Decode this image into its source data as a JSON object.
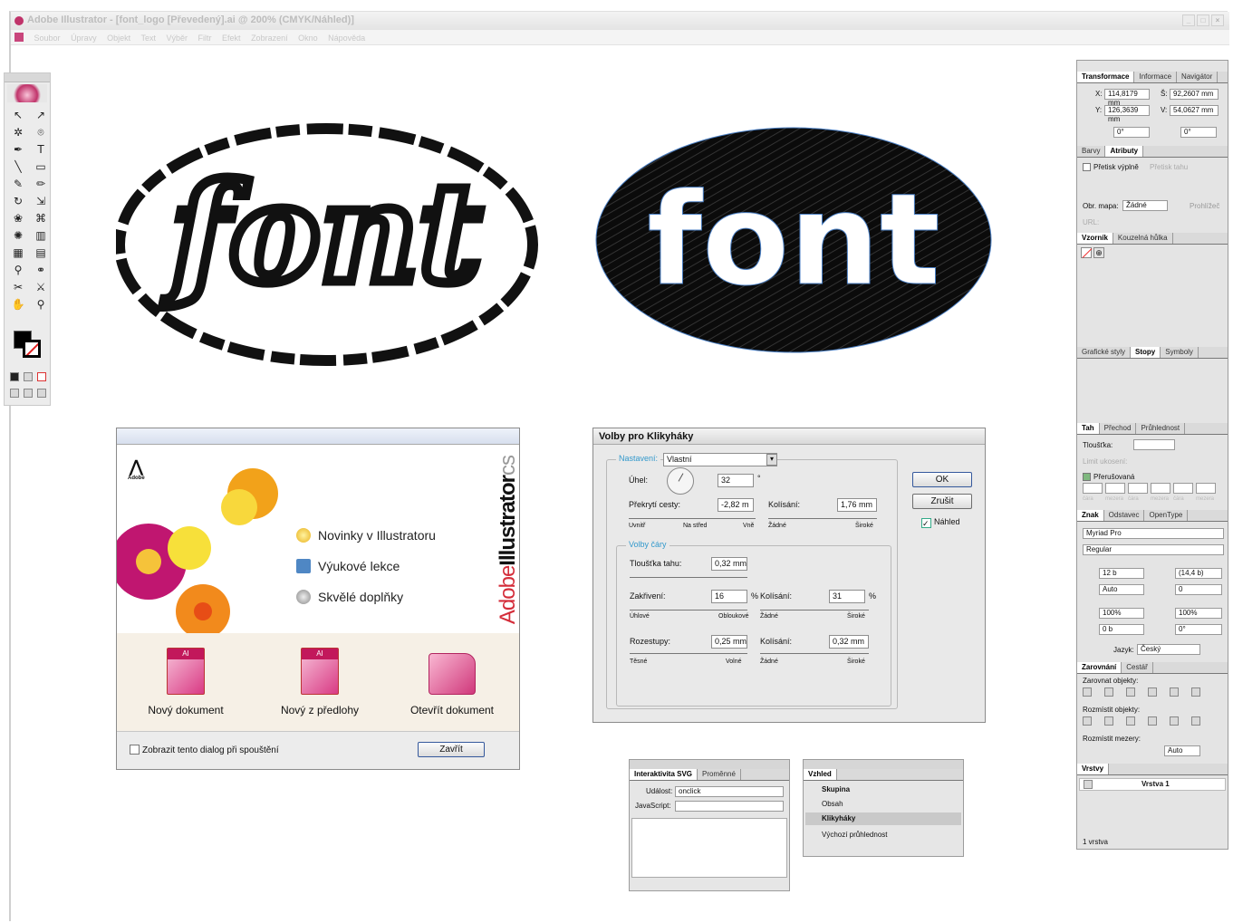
{
  "window": {
    "title": "Adobe Illustrator - [font_logo [Převedený].ai @ 200% (CMYK/Náhled)]",
    "buttons": [
      "_",
      "□",
      "×"
    ]
  },
  "menu": {
    "items": [
      "Soubor",
      "Úpravy",
      "Objekt",
      "Text",
      "Výběr",
      "Filtr",
      "Efekt",
      "Zobrazení",
      "Okno",
      "Nápověda"
    ]
  },
  "artwork": {
    "left_text": "font",
    "right_text": "font"
  },
  "welcome": {
    "brand_adobe": "Adobe",
    "brand_product": "Illustrator",
    "brand_cs": "cs",
    "adobe_logo_text": "Adobe",
    "links": [
      "Novinky v Illustratoru",
      "Výukové lekce",
      "Skvělé doplňky"
    ],
    "docs": [
      "Nový dokument",
      "Nový z předlohy",
      "Otevřít dokument"
    ],
    "doc_badge": "AI",
    "checkbox": "Zobrazit tento dialog při spouštění",
    "close": "Zavřít"
  },
  "scribble": {
    "title": "Volby pro Klikyháky",
    "settings_label": "Nastavení:",
    "settings_value": "Vlastní",
    "angle_label": "Úhel:",
    "angle_value": "32",
    "angle_unit": "°",
    "overlap_label": "Překrytí cesty:",
    "overlap_value": "-2,82 m",
    "variation_label": "Kolísání:",
    "overlap_var_value": "1,76 mm",
    "overlap_ticks": [
      "Uvnitř",
      "Na střed",
      "Vně"
    ],
    "var_ticks": [
      "Žádné",
      "Široké"
    ],
    "line_options": "Volby čáry",
    "stroke_width_label": "Tloušťka tahu:",
    "stroke_width_value": "0,32 mm",
    "curviness_label": "Zakřivení:",
    "curviness_value": "16",
    "curviness_var": "31",
    "percent": "%",
    "curve_ticks": [
      "Úhlové",
      "Obloukové"
    ],
    "spacing_label": "Rozestupy:",
    "spacing_value": "0,25 mm",
    "spacing_var": "0,32 mm",
    "spacing_ticks": [
      "Těsné",
      "Volné"
    ],
    "ok": "OK",
    "cancel": "Zrušit",
    "preview": "Náhled"
  },
  "svg_panel": {
    "tabs": [
      "Interaktivita SVG",
      "Proměnné"
    ],
    "event_label": "Událost:",
    "event_value": "onclick",
    "js_label": "JavaScript:"
  },
  "appearance_panel": {
    "tab": "Vzhled",
    "rows": [
      "Skupina",
      "Obsah",
      "Klikyháky",
      "Výchozí průhlednost"
    ]
  },
  "right": {
    "transform_tabs": [
      "Transformace",
      "Informace",
      "Navigátor"
    ],
    "x_label": "X:",
    "x": "114,8179 mm",
    "w_label": "Š:",
    "w": "92,2607 mm",
    "y_label": "Y:",
    "y": "126,3639 mm",
    "h_label": "V:",
    "h": "54,0627 mm",
    "angle1": "0°",
    "angle2": "0°",
    "attr_tabs": [
      "Barvy",
      "Atributy"
    ],
    "overprint": "Přetisk výplně",
    "overprint2": "Přetisk tahu",
    "imgmap_label": "Obr. mapa:",
    "imgmap_value": "Žádné",
    "browser": "Prohlížeč",
    "url_label": "URL:",
    "swatch_tabs": [
      "Vzorník",
      "Kouzelná hůlka"
    ],
    "style_tabs": [
      "Grafické styly",
      "Stopy",
      "Symboly"
    ],
    "stroke_tabs": [
      "Tah",
      "Přechod",
      "Průhlednost"
    ],
    "weight_label": "Tloušťka:",
    "limit_label": "Limit ukosení:",
    "dashed": "Přerušovaná",
    "dash_labels": [
      "čára",
      "mezera",
      "čára",
      "mezera",
      "čára",
      "mezera"
    ],
    "char_tabs": [
      "Znak",
      "Odstavec",
      "OpenType"
    ],
    "font": "Myriad Pro",
    "style": "Regular",
    "size": "12 b",
    "leading": "(14,4 b)",
    "kern": "Auto",
    "track": "0",
    "hscale": "100%",
    "vscale": "100%",
    "baseline": "0 b",
    "rotate": "0°",
    "lang_label": "Jazyk:",
    "lang": "Český",
    "align_tabs": [
      "Zarovnání",
      "Cestář"
    ],
    "align_objects": "Zarovnat objekty:",
    "distribute_objects": "Rozmístit objekty:",
    "distribute_spacing": "Rozmístit mezery:",
    "spacing_value": "Auto",
    "layers_tab": "Vrstvy",
    "layer_name": "Vrstva 1",
    "layer_count": "1 vrstva"
  },
  "colors": {
    "accent": "#3399cc",
    "brand": "#d42d3a",
    "pink": "#c2185b"
  }
}
